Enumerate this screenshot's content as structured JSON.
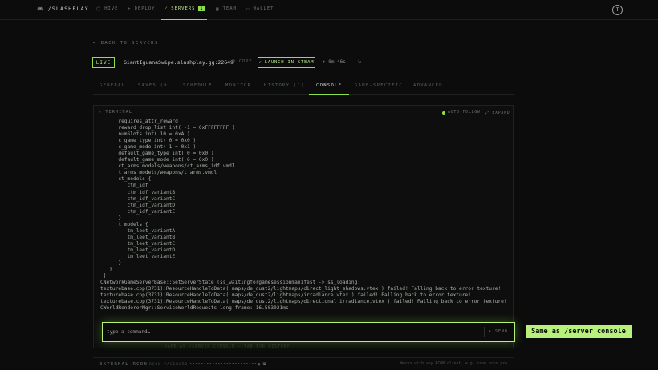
{
  "nav": {
    "brand_icon": "gamepad-icon",
    "brand": "/SLASHPLAY",
    "items": [
      {
        "label": "HIVE",
        "icon": "hive-icon"
      },
      {
        "label": "DEPLOY",
        "icon": "plus-icon"
      },
      {
        "label": "SERVERS",
        "icon": "servers-icon",
        "badge": "1"
      },
      {
        "label": "TEAM",
        "icon": "team-icon"
      },
      {
        "label": "WALLET",
        "icon": "wallet-icon"
      }
    ],
    "avatar": "T"
  },
  "back_label": "← BACK TO SERVERS",
  "server": {
    "status": "LIVE",
    "address": "GiantIguanaSwipe.slashplay.gg:22649",
    "copy_label": "COPY",
    "steam_label": "LAUNCH IN STEAM",
    "uptime": "↑ 0m 46s"
  },
  "tabs": [
    "GENERAL",
    "SAVES (0)",
    "SCHEDULE",
    "MONITOR",
    "HISTORY (1)",
    "CONSOLE",
    "GAME-SPECIFIC",
    "ADVANCED"
  ],
  "terminal": {
    "title": "▸ TERMINAL",
    "autofollow_label": "AUTO-FOLLOW",
    "expand_label": "⤢ EXPAND",
    "lines": [
      "      requires_attr_reward",
      "      reward_drop_list int( -1 = 0xFFFFFFFF )",
      "      numSlots int( 10 = 0xA )",
      "      c_game_type int( 0 = 0x0 )",
      "      c_game_mode int( 1 = 0x1 )",
      "      default_game_type int( 0 = 0x0 )",
      "      default_game_mode int( 0 = 0x0 )",
      "      ct_arms models/weapons/ct_arms_idf.vmdl",
      "      t_arms models/weapons/t_arms.vmdl",
      "      ct_models {",
      "         ctm_idf",
      "         ctm_idf_variantB",
      "         ctm_idf_variantC",
      "         ctm_idf_variantD",
      "         ctm_idf_variantE",
      "      }",
      "      t_models {",
      "         tm_leet_variantA",
      "         tm_leet_variantB",
      "         tm_leet_variantC",
      "         tm_leet_variantD",
      "         tm_leet_variantE",
      "      }",
      "   }",
      " }",
      "CNetworkGameServerBase::SetServerState (ss_waitingforgamesessionmanifest -> ss_loading)",
      "texturebase.cpp(3731):ResourceHandleToData( maps/de_dust2/lightmaps/direct_light_shadows.vtex ) failed! Falling back to error texture!",
      "texturebase.cpp(3731):ResourceHandleToData( maps/de_dust2/lightmaps/irradiance.vtex ) failed! Falling back to error texture!",
      "texturebase.cpp(3731):ResourceHandleToData( maps/de_dust2/lightmaps/directional_irradiance.vtex ) failed! Falling back to error texture!",
      "CWorldRendererMgr::ServiceWorldRequests long frame: 16.503021ms"
    ]
  },
  "command": {
    "placeholder": "type a command…",
    "send_label": "SEND"
  },
  "ghost_text": "SAME AS /SERVER CONSOLE — TAB FOR HISTORY",
  "callout": "Same as /server console",
  "rcon": {
    "label": "EXTERNAL RCON",
    "password_label": "RCON PASSWORD",
    "password": "••••••••••••••••••••••••",
    "hint": "Works with any RCON client, e.g. rcon.pros.pro"
  },
  "colors": {
    "accent": "#8ee04a",
    "accent_light": "#b7f07a",
    "bg": "#0b0c0b"
  }
}
